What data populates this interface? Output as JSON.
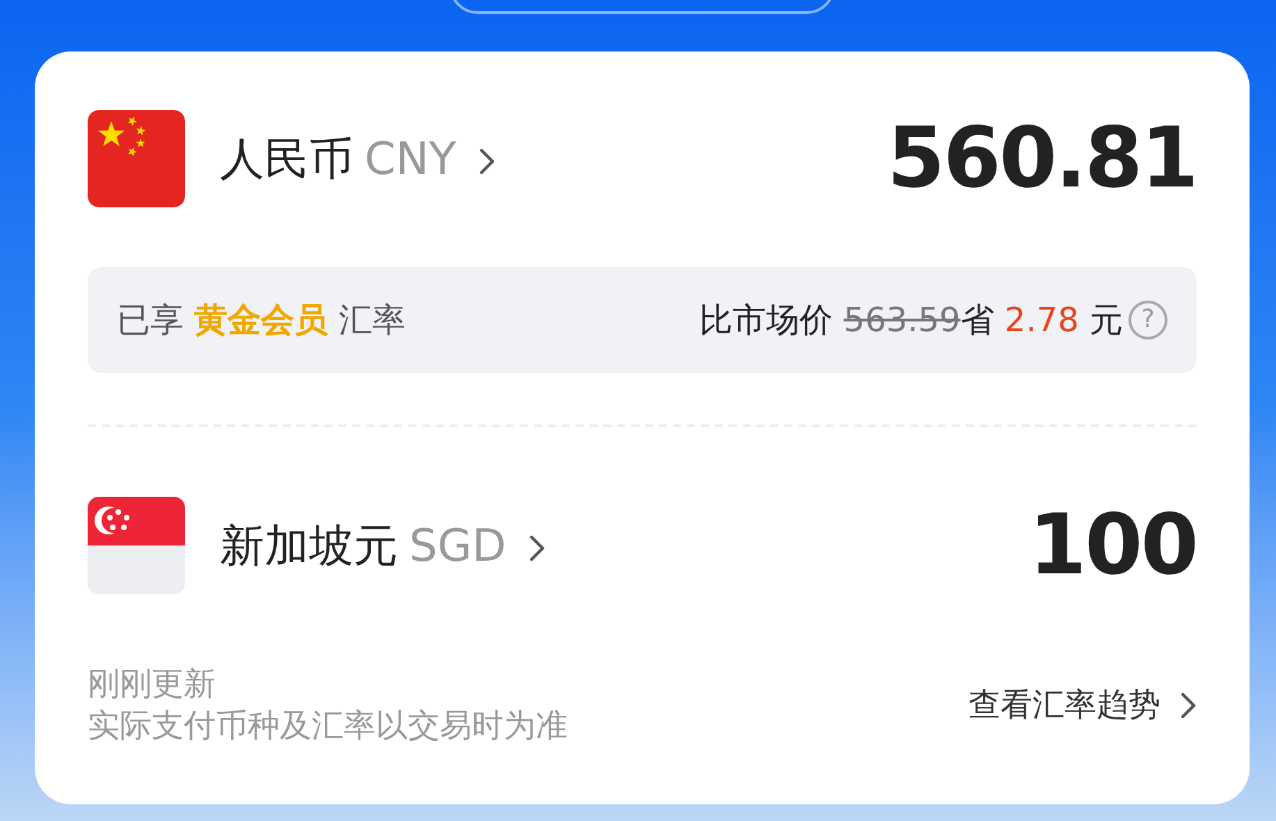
{
  "currencies": [
    {
      "kind": "cn",
      "name": "人民币",
      "code": "CNY",
      "amount": "560.81"
    },
    {
      "kind": "sg",
      "name": "新加坡元",
      "code": "SGD",
      "amount": "100"
    }
  ],
  "rate_panel": {
    "prefix": "已享",
    "tier": "黄金会员",
    "suffix": "汇率",
    "compare_label": "比市场价",
    "market_price": "563.59",
    "save_label": "省",
    "saved": "2.78",
    "unit": "元",
    "help": "?"
  },
  "footer": {
    "updated": "刚刚更新",
    "note": "实际支付币种及汇率以交易时为准",
    "trend_link": "查看汇率趋势"
  }
}
